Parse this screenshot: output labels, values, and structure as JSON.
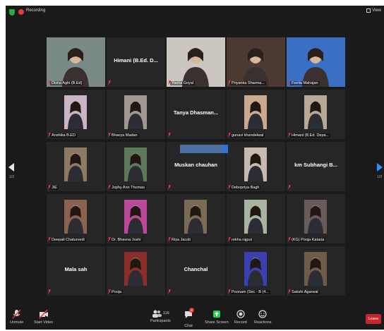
{
  "header": {
    "recording_label": "Recording",
    "view_label": "View"
  },
  "pagination": {
    "left": "1/3",
    "right": "1/3"
  },
  "chat_float_text": "",
  "participants": [
    {
      "name": "Disha Aghi (B.Ed)",
      "type": "video",
      "bg": "#7a8a86"
    },
    {
      "name": "Himani (B.Ed. D...",
      "type": "name"
    },
    {
      "name": "Yasha Goyal",
      "type": "video",
      "bg": "#cbc7c0"
    },
    {
      "name": "Priyanka Sharma...",
      "type": "video",
      "bg": "#4c3a32",
      "active": true
    },
    {
      "name": "Feelia Mahajan",
      "type": "video",
      "bg": "#3a6fc4"
    },
    {
      "name": "Anshika B.ED",
      "type": "photo",
      "bg": "#c9b5c4"
    },
    {
      "name": "Bhavya Madan",
      "type": "photo",
      "bg": "#9e9a92"
    },
    {
      "name": "Tanya Dhasman...",
      "type": "name"
    },
    {
      "name": "gunavi khandelwal",
      "type": "photo",
      "bg": "#caa98e"
    },
    {
      "name": "Himani (B.Ed. Depa...",
      "type": "photo",
      "bg": "#b7a996"
    },
    {
      "name": "JIE",
      "type": "photo",
      "bg": "#8c7a63"
    },
    {
      "name": "Jophy Ann Thomas",
      "type": "photo",
      "bg": "#5c7a5a"
    },
    {
      "name": "Muskan chauhan",
      "type": "name"
    },
    {
      "name": "Debopriya Bagh",
      "type": "photo",
      "bg": "#c8bab0"
    },
    {
      "name": "km Subhangi B...",
      "type": "name"
    },
    {
      "name": "Deepali Chaturvedi",
      "type": "photo",
      "bg": "#8a6250"
    },
    {
      "name": "Dr. Bhavna Joshi",
      "type": "photo",
      "bg": "#b94a9a"
    },
    {
      "name": "Riya Jacob",
      "type": "photo",
      "bg": "#7b6a56"
    },
    {
      "name": "rekha rajput",
      "type": "photo",
      "bg": "#a9b4a0"
    },
    {
      "name": "(KG) Pooja Kataria",
      "type": "photo",
      "bg": "#6b5a5a"
    },
    {
      "name": "Mala sah",
      "type": "name"
    },
    {
      "name": "Pooja",
      "type": "photo",
      "bg": "#8b2e2a"
    },
    {
      "name": "Chanchal",
      "type": "name"
    },
    {
      "name": "Poonam (Sec - B (4...",
      "type": "photo",
      "bg": "#3a3fb2"
    },
    {
      "name": "Sakshi Agarwal",
      "type": "photo",
      "bg": "#6e5b48"
    }
  ],
  "toolbar": {
    "unmute": "Unmute",
    "start_video": "Start Video",
    "participants": "Participants",
    "participants_count": "116",
    "chat": "Chat",
    "chat_badge": "2",
    "share_screen": "Share Screen",
    "record": "Record",
    "reactions": "Reactions",
    "leave": "Leave"
  },
  "colors": {
    "share_green": "#2fcc54",
    "leave_red": "#c8242c",
    "active_border": "#d6d83a",
    "tile_bg": "#262626"
  }
}
